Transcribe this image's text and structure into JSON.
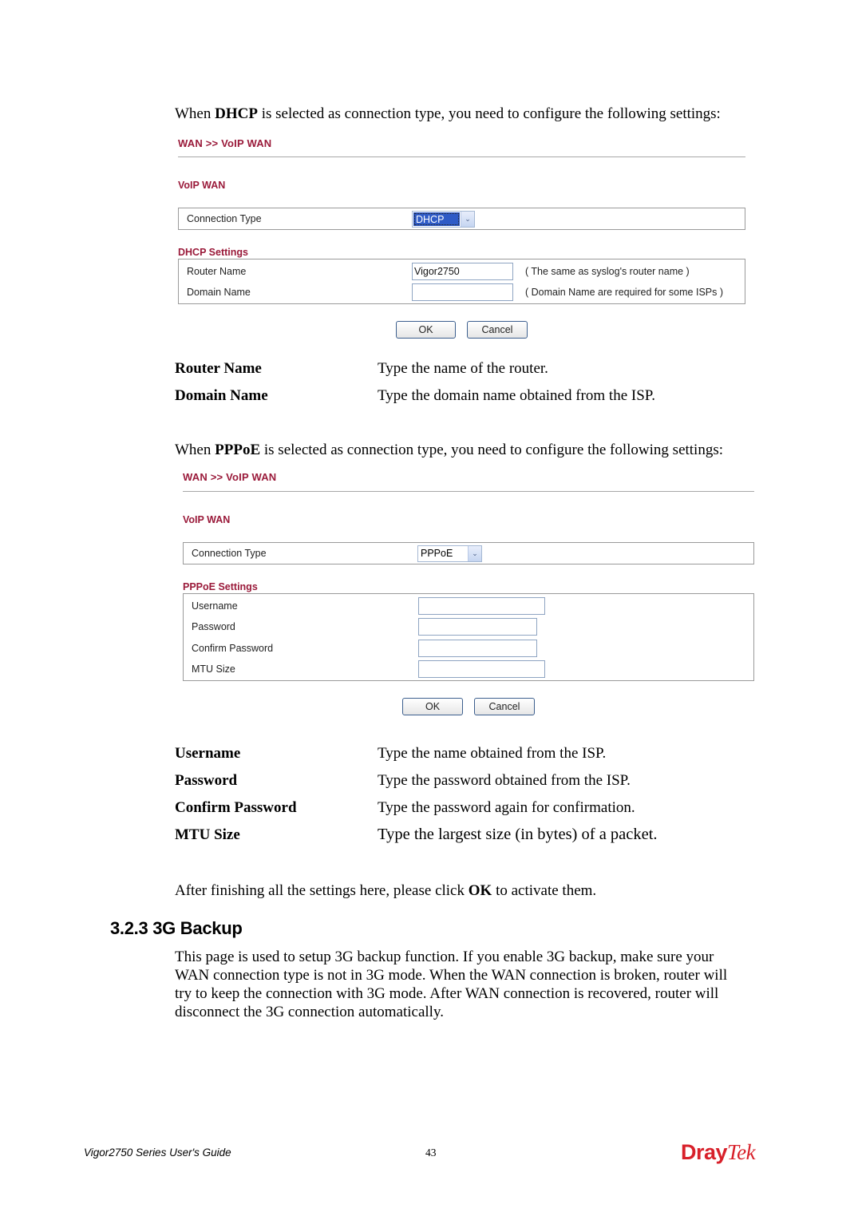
{
  "dhcp_intro": {
    "before": "When ",
    "bold": "DHCP",
    "after": " is selected as connection type, you need to configure the following settings:"
  },
  "dhcp_screen": {
    "breadcrumb": "WAN >> VoIP WAN",
    "section_title": "VoIP WAN",
    "connection_type_label": "Connection Type",
    "connection_type_value": "DHCP",
    "settings_title": "DHCP Settings",
    "fields": [
      {
        "label": "Router Name",
        "value": "Vigor2750",
        "hint": "( The same as syslog's router name )"
      },
      {
        "label": "Domain Name",
        "value": "",
        "hint": "( Domain Name are required for some ISPs )"
      }
    ],
    "ok_label": "OK",
    "cancel_label": "Cancel"
  },
  "dhcp_terms": [
    {
      "term": "Router Name",
      "desc": "Type the name of the router."
    },
    {
      "term": "Domain Name",
      "desc": "Type the domain name obtained from the ISP."
    }
  ],
  "pppoe_intro": {
    "before": "When ",
    "bold": "PPPoE",
    "after": " is selected as connection type, you need to configure the following settings:"
  },
  "pppoe_screen": {
    "breadcrumb": "WAN >> VoIP WAN",
    "section_title": "VoIP WAN",
    "connection_type_label": "Connection Type",
    "connection_type_value": "PPPoE",
    "settings_title": "PPPoE Settings",
    "fields": [
      {
        "label": "Username",
        "value": ""
      },
      {
        "label": "Password",
        "value": ""
      },
      {
        "label": "Confirm Password",
        "value": ""
      },
      {
        "label": "MTU Size",
        "value": ""
      }
    ],
    "ok_label": "OK",
    "cancel_label": "Cancel"
  },
  "pppoe_terms": [
    {
      "term": "Username",
      "desc": "Type the name obtained from the ISP."
    },
    {
      "term": "Password",
      "desc": "Type the password obtained from the ISP."
    },
    {
      "term": "Confirm Password",
      "desc": "Type the password again for confirmation."
    },
    {
      "term": "MTU Size",
      "desc": "Type the largest size (in bytes) of a packet."
    }
  ],
  "finish_note": {
    "before": "After finishing all the settings here, please click ",
    "bold": "OK",
    "after": " to activate them."
  },
  "section_3g": {
    "heading": "3.2.3 3G Backup",
    "lines": [
      "This page is used to setup 3G backup function. If you enable 3G backup, make sure your",
      "WAN connection type is not in 3G mode. When the WAN connection is broken, router will",
      "try to keep the connection with 3G mode. After WAN connection is recovered, router will",
      "disconnect the 3G connection automatically."
    ]
  },
  "footer": {
    "guide_title": "Vigor2750 Series User's Guide",
    "page_number": "43",
    "logo_part1": "Dray",
    "logo_part2": "Tek"
  }
}
